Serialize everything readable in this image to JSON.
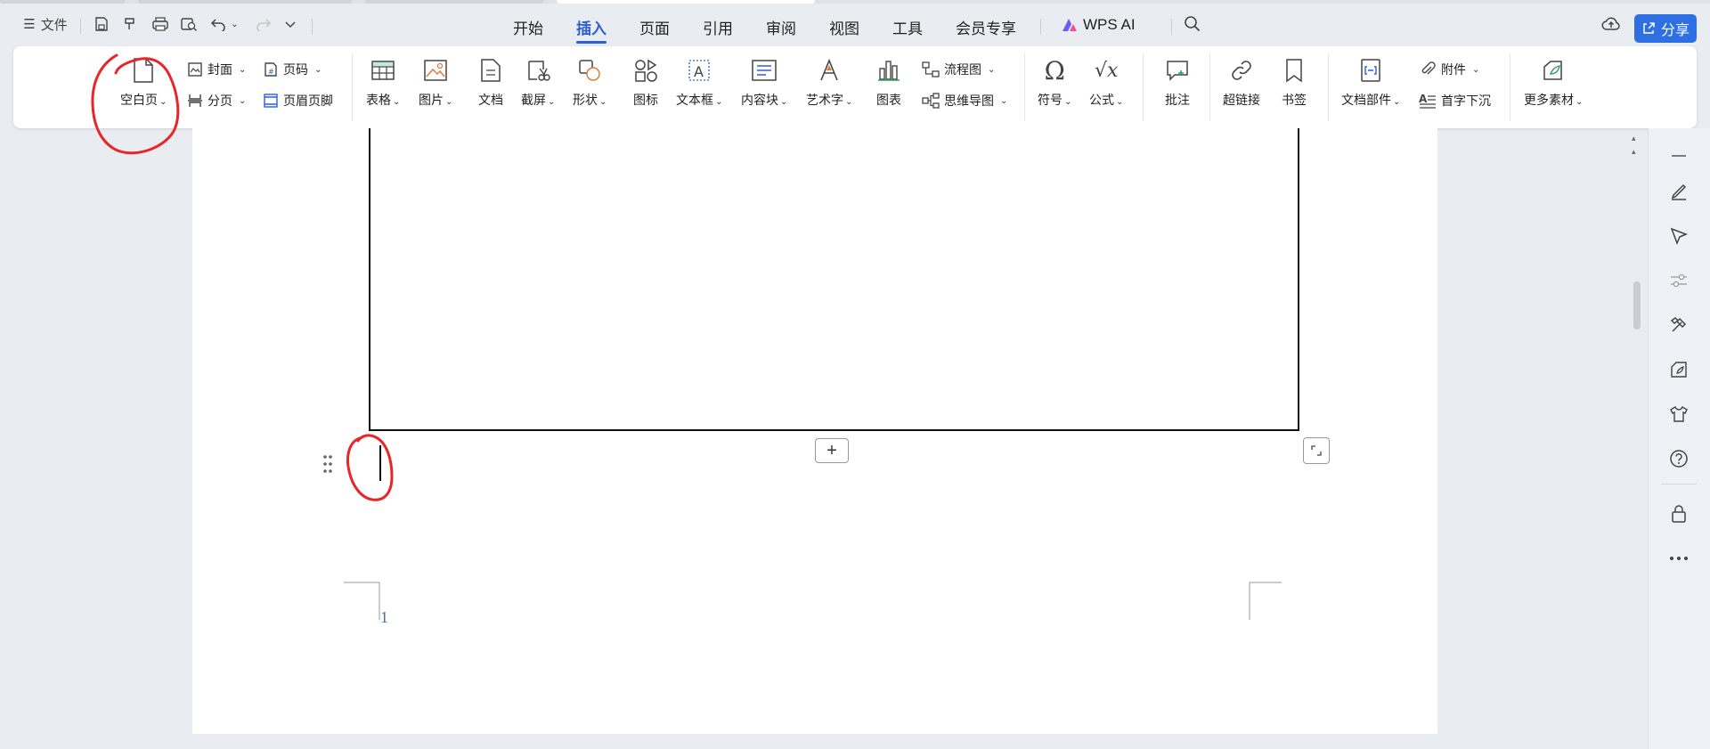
{
  "titlebar": {
    "menu_icon": "☰",
    "file_label": "文件",
    "tabs": [
      {
        "label": "开始",
        "active": false
      },
      {
        "label": "插入",
        "active": true
      },
      {
        "label": "页面",
        "active": false
      },
      {
        "label": "引用",
        "active": false
      },
      {
        "label": "审阅",
        "active": false
      },
      {
        "label": "视图",
        "active": false
      },
      {
        "label": "工具",
        "active": false
      },
      {
        "label": "会员专享",
        "active": false
      },
      {
        "label": "WPS AI",
        "active": false
      }
    ],
    "share_label": "分享",
    "accent_color": "#2b5fd9"
  },
  "ribbon": {
    "blank_page": "空白页",
    "cover": "封面",
    "page_break": "分页",
    "page_number": "页码",
    "header_footer": "页眉页脚",
    "table": "表格",
    "picture": "图片",
    "document": "文档",
    "screenshot": "截屏",
    "shape": "形状",
    "icons": "图标",
    "textbox": "文本框",
    "content_block": "内容块",
    "wordart": "艺术字",
    "chart": "图表",
    "flowchart": "流程图",
    "mindmap": "思维导图",
    "symbol": "符号",
    "formula": "公式",
    "comment": "批注",
    "hyperlink": "超链接",
    "bookmark": "书签",
    "doc_parts": "文档部件",
    "attachment": "附件",
    "drop_cap": "首字下沉",
    "more_materials": "更多素材"
  },
  "document": {
    "page_number": "1",
    "add_row_symbol": "+"
  },
  "annotation_color": "#e8262a"
}
